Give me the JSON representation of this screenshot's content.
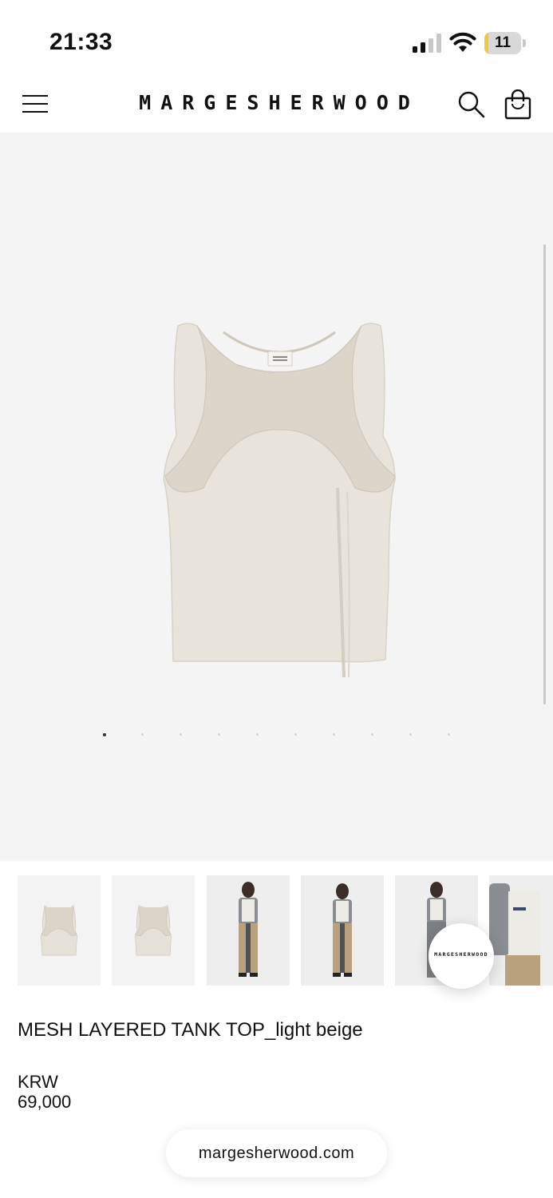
{
  "status_bar": {
    "time": "21:33",
    "battery": "11",
    "battery_level": 0.11,
    "battery_color": "#f0c93b"
  },
  "header": {
    "brand": "MARGESHERWOOD",
    "menu_icon": "hamburger-menu-icon",
    "search_icon": "search-icon",
    "bag_icon": "shopping-bag-icon"
  },
  "carousel": {
    "total_images": 10,
    "active_index": 0
  },
  "thumbnails": [
    {
      "name": "thumb-1",
      "kind": "product-front"
    },
    {
      "name": "thumb-2",
      "kind": "product-back"
    },
    {
      "name": "thumb-3",
      "kind": "model-front"
    },
    {
      "name": "thumb-4",
      "kind": "model-front"
    },
    {
      "name": "thumb-5",
      "kind": "model-back"
    },
    {
      "name": "thumb-6",
      "kind": "model-detail"
    }
  ],
  "floating_badge": {
    "label": "MARGESHERWOOD"
  },
  "product": {
    "title": "MESH LAYERED TANK TOP_light beige",
    "currency": "KRW",
    "price": "69,000"
  },
  "browser": {
    "url": "margesherwood.com"
  },
  "colors": {
    "hero_bg": "#f4f4f4",
    "garment": "#e7e2da"
  }
}
